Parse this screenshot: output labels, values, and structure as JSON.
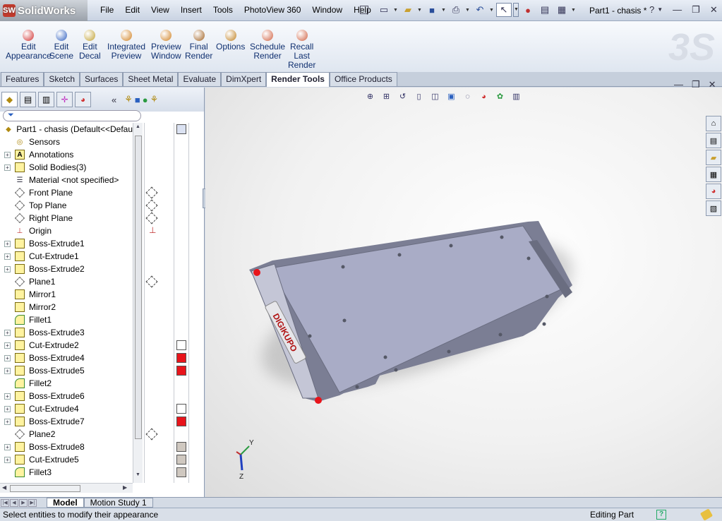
{
  "app": {
    "logo_text": "SolidWorks",
    "doc_title": "Part1 - chasis *",
    "help_label": "?"
  },
  "menu": [
    "File",
    "Edit",
    "View",
    "Insert",
    "Tools",
    "PhotoView 360",
    "Window",
    "Help"
  ],
  "commands": [
    {
      "l1": "Edit",
      "l2": "Appearance",
      "l3": "",
      "icon_color": "#d03030"
    },
    {
      "l1": "Edit",
      "l2": "Scene",
      "l3": "",
      "icon_color": "#3060c0"
    },
    {
      "l1": "Edit",
      "l2": "Decal",
      "l3": "",
      "icon_color": "#c0a030"
    },
    {
      "l1": "Integrated",
      "l2": "Preview",
      "l3": "",
      "icon_color": "#d08020"
    },
    {
      "l1": "Preview",
      "l2": "Window",
      "l3": "",
      "icon_color": "#d08020"
    },
    {
      "l1": "Final",
      "l2": "Render",
      "l3": "",
      "icon_color": "#a06020"
    },
    {
      "l1": "Options",
      "l2": "",
      "l3": "",
      "icon_color": "#c08020"
    },
    {
      "l1": "Schedule",
      "l2": "Render",
      "l3": "",
      "icon_color": "#d06040"
    },
    {
      "l1": "Recall",
      "l2": "Last",
      "l3": "Render",
      "icon_color": "#d06040"
    }
  ],
  "tabs": [
    "Features",
    "Sketch",
    "Surfaces",
    "Sheet Metal",
    "Evaluate",
    "DimXpert",
    "Render Tools",
    "Office Products"
  ],
  "active_tab": "Render Tools",
  "tree": {
    "root": "Part1 - chasis  (Default<<Defau",
    "items": [
      {
        "label": "Sensors",
        "type": "sensor",
        "expand": false
      },
      {
        "label": "Annotations",
        "type": "annot",
        "expand": true
      },
      {
        "label": "Solid Bodies(3)",
        "type": "folder",
        "expand": true
      },
      {
        "label": "Material <not specified>",
        "type": "material",
        "expand": false
      },
      {
        "label": "Front Plane",
        "type": "plane",
        "expand": false,
        "mark": "plane"
      },
      {
        "label": "Top Plane",
        "type": "plane",
        "expand": false,
        "mark": "plane"
      },
      {
        "label": "Right Plane",
        "type": "plane",
        "expand": false,
        "mark": "plane"
      },
      {
        "label": "Origin",
        "type": "origin",
        "expand": false,
        "mark": "origin"
      },
      {
        "label": "Boss-Extrude1",
        "type": "feat",
        "expand": true
      },
      {
        "label": "Cut-Extrude1",
        "type": "feat",
        "expand": true
      },
      {
        "label": "Boss-Extrude2",
        "type": "feat",
        "expand": true
      },
      {
        "label": "Plane1",
        "type": "plane",
        "expand": false,
        "mark": "plane"
      },
      {
        "label": "Mirror1",
        "type": "feat",
        "expand": false
      },
      {
        "label": "Mirror2",
        "type": "feat",
        "expand": false
      },
      {
        "label": "Fillet1",
        "type": "fillet",
        "expand": false
      },
      {
        "label": "Boss-Extrude3",
        "type": "feat",
        "expand": true
      },
      {
        "label": "Cut-Extrude2",
        "type": "feat",
        "expand": true,
        "swatch": "#ffffff"
      },
      {
        "label": "Boss-Extrude4",
        "type": "feat",
        "expand": true,
        "swatch": "#e8141b"
      },
      {
        "label": "Boss-Extrude5",
        "type": "feat",
        "expand": true,
        "swatch": "#e8141b"
      },
      {
        "label": "Fillet2",
        "type": "fillet",
        "expand": false
      },
      {
        "label": "Boss-Extrude6",
        "type": "feat",
        "expand": true
      },
      {
        "label": "Cut-Extrude4",
        "type": "feat",
        "expand": true,
        "swatch": "#ffffff"
      },
      {
        "label": "Boss-Extrude7",
        "type": "feat",
        "expand": true,
        "swatch": "#e8141b"
      },
      {
        "label": "Plane2",
        "type": "plane",
        "expand": false,
        "mark": "plane"
      },
      {
        "label": "Boss-Extrude8",
        "type": "feat",
        "expand": true,
        "swatch": "#cfc8c0"
      },
      {
        "label": "Cut-Extrude5",
        "type": "feat",
        "expand": true,
        "swatch": "#cfc8c0"
      },
      {
        "label": "Fillet3",
        "type": "fillet",
        "expand": false,
        "swatch": "#cfc8c0"
      }
    ],
    "root_swatch": "#dbe2f2"
  },
  "model": {
    "decal_text": "DIGIKUPO",
    "body_color": "#a9acc6",
    "accent_color": "#e8141b"
  },
  "bottom_tabs": [
    "Model",
    "Motion Study 1"
  ],
  "status": {
    "message": "Select entities to modify their appearance",
    "mode": "Editing Part"
  }
}
